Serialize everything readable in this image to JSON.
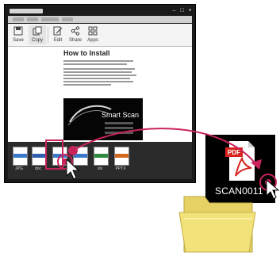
{
  "toolbar": {
    "buttons": [
      {
        "label": "Save",
        "icon": "save-icon"
      },
      {
        "label": "Copy",
        "icon": "copy-icon"
      },
      {
        "label": "Edit",
        "icon": "edit-icon"
      },
      {
        "label": "Share",
        "icon": "share-icon"
      },
      {
        "label": "Apps",
        "icon": "apps-icon"
      }
    ]
  },
  "document": {
    "heading": "How to Install",
    "image_brand": "Smart Scan"
  },
  "filmstrip": {
    "thumbnails": [
      {
        "label": "JPG",
        "icon": "image-file-icon",
        "color": "#3a78c9"
      },
      {
        "label": "doc",
        "icon": "word-file-icon",
        "color": "#2f5fb0"
      },
      {
        "label": "",
        "icon": "image-file-icon",
        "color": "#3a78c9"
      },
      {
        "label": "",
        "icon": "cursor-icon",
        "color": "#3a78c9"
      },
      {
        "label": "xls",
        "icon": "excel-file-icon",
        "color": "#2e8b3e"
      },
      {
        "label": "PPTX",
        "icon": "powerpoint-file-icon",
        "color": "#d2691e"
      }
    ]
  },
  "scan_panel": {
    "file_name": "SCAN0011",
    "file_icon": "pdf-file-icon",
    "pdf_label": "PDF"
  },
  "folder": {
    "icon": "folder-icon",
    "color": "#f2e27a"
  },
  "colors": {
    "accent": "#c8245c",
    "pdf_red": "#d9231f"
  }
}
